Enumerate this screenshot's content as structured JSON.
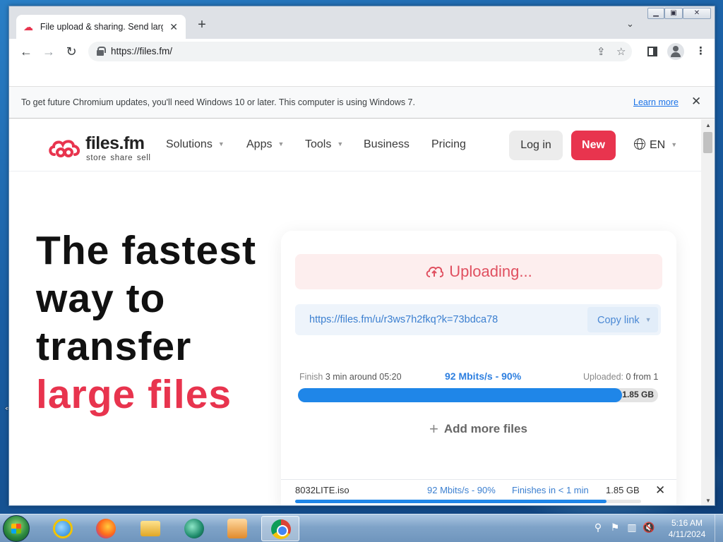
{
  "browser": {
    "tab_title": "File upload & sharing. Send large files",
    "url": "https://files.fm/"
  },
  "infobar": {
    "message": "To get future Chromium updates, you'll need Windows 10 or later. This computer is using Windows 7.",
    "link": "Learn more"
  },
  "site": {
    "logo_name": "files.fm",
    "logo_tagline": "store share sell",
    "nav": [
      "Solutions",
      "Apps",
      "Tools",
      "Business",
      "Pricing"
    ],
    "login_label": "Log in",
    "new_label": "New",
    "lang_label": "EN",
    "colors": {
      "brand": "#e8344e",
      "accent": "#1f86e8"
    }
  },
  "hero": {
    "line1": "The fastest",
    "line2": "way to",
    "line3": "transfer",
    "line4": "large files"
  },
  "upload": {
    "status": "Uploading...",
    "share_link": "https://files.fm/u/r3ws7h2fkq?k=73bdca78",
    "copy_label": "Copy link",
    "finish_label": "Finish",
    "finish_value": "3 min around 05:20",
    "speed_summary": "92 Mbits/s - 90%",
    "uploaded_label": "Uploaded:",
    "uploaded_value": "0 from 1",
    "progress_percent": 90,
    "total_size": "1.85 GB",
    "add_more": "Add more files"
  },
  "file": {
    "name": "8032LITE.iso",
    "speed": "92 Mbits/s - 90%",
    "eta": "Finishes in < 1 min",
    "size": "1.85 GB",
    "progress_percent": 90
  },
  "taskbar": {
    "clock_time": "5:16 AM",
    "clock_date": "4/11/2024"
  }
}
